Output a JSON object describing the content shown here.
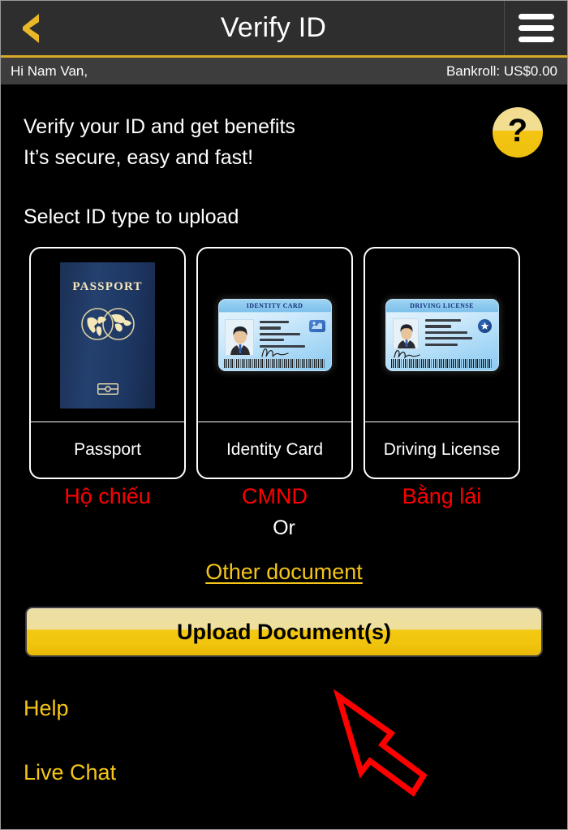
{
  "titlebar": {
    "back_icon": "chevron-left-icon",
    "title": "Verify ID",
    "menu_icon": "hamburger-menu-icon",
    "accent_color": "#d9a92a",
    "bg_color": "#2e2e2e"
  },
  "userbar": {
    "greeting": "Hi Nam Van,",
    "bankroll": "Bankroll: US$0.00",
    "bg_color": "#3d3d3d"
  },
  "intro": {
    "line1": "Verify your ID and get benefits",
    "line2": "It’s secure, easy and fast!",
    "help_icon": "question-mark-icon",
    "help_glyph": "?"
  },
  "section": {
    "select_label": "Select ID type to upload"
  },
  "cards": [
    {
      "id": "passport",
      "label": "Passport",
      "annotation": "Hộ chiếu",
      "art": "passport-book",
      "art_title": "PASSPORT"
    },
    {
      "id": "identity-card",
      "label": "Identity Card",
      "annotation": "CMND",
      "art": "id-card",
      "art_title": "IDENTITY CARD"
    },
    {
      "id": "driving-license",
      "label": "Driving License",
      "annotation": "Bằng lái",
      "art": "id-card",
      "art_title": "DRIVING LICENSE"
    }
  ],
  "or_text": "Or",
  "other_document_link": "Other document",
  "upload_button": "Upload Document(s)",
  "footer": {
    "help": "Help",
    "live_chat": "Live Chat"
  },
  "annotation_overlay": {
    "arrow_icon": "red-arrow-pointing-up-left",
    "arrow_color": "#ff0000",
    "annotation_text_color": "#ff0000"
  }
}
